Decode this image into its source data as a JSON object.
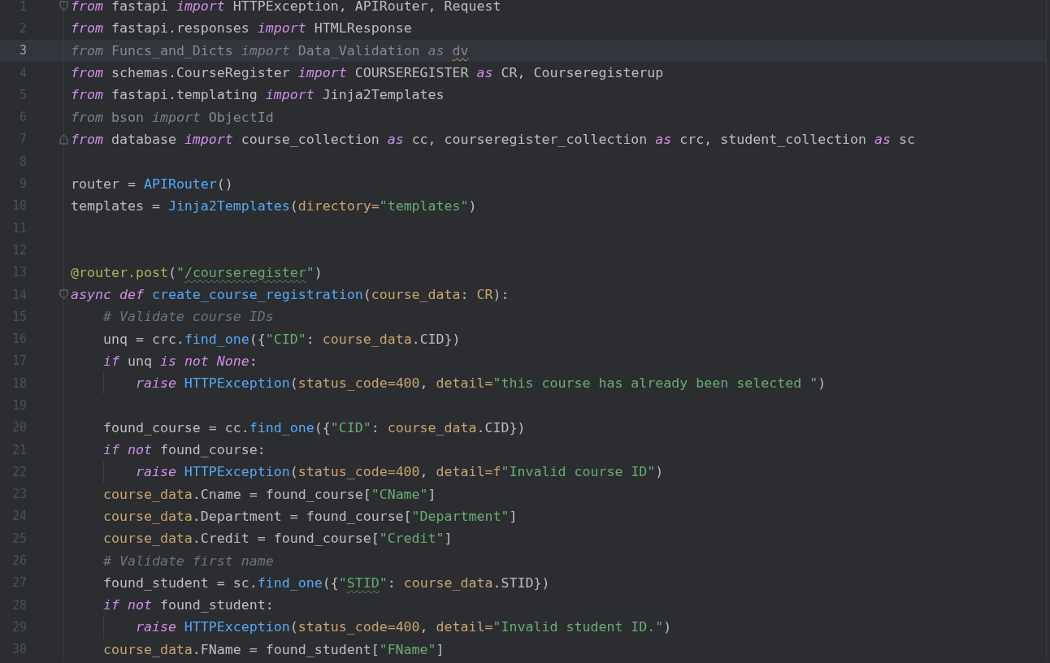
{
  "lines": [
    {
      "n": "1",
      "current": false,
      "fold_start": true,
      "tokens": [
        {
          "kind": "kw",
          "text": "from"
        },
        {
          "kind": "plain",
          "text": " fastapi "
        },
        {
          "kind": "kw",
          "text": "import"
        },
        {
          "kind": "plain",
          "text": " HTTPException, APIRouter, Request"
        }
      ]
    },
    {
      "n": "2",
      "current": false,
      "tokens": [
        {
          "kind": "kw",
          "text": "from"
        },
        {
          "kind": "plain",
          "text": " fastapi.responses "
        },
        {
          "kind": "kw",
          "text": "import"
        },
        {
          "kind": "plain",
          "text": " HTMLResponse"
        }
      ]
    },
    {
      "n": "3",
      "current": true,
      "tokens": [
        {
          "kind": "kwd",
          "text": "from"
        },
        {
          "kind": "dim",
          "text": " Funcs_and_Dicts "
        },
        {
          "kind": "kwd",
          "text": "import"
        },
        {
          "kind": "dim",
          "text": " Data_Validation "
        },
        {
          "kind": "kwd",
          "text": "as "
        },
        {
          "kind": "dim",
          "text": "dv",
          "warning": true
        }
      ]
    },
    {
      "n": "4",
      "current": false,
      "tokens": [
        {
          "kind": "kw",
          "text": "from"
        },
        {
          "kind": "plain",
          "text": " schemas.CourseRegister "
        },
        {
          "kind": "kw",
          "text": "import"
        },
        {
          "kind": "plain",
          "text": " COURSEREGISTER "
        },
        {
          "kind": "kw",
          "text": "as"
        },
        {
          "kind": "plain",
          "text": " CR, Courseregisterup"
        }
      ]
    },
    {
      "n": "5",
      "current": false,
      "tokens": [
        {
          "kind": "kw",
          "text": "from"
        },
        {
          "kind": "plain",
          "text": " fastapi.templating "
        },
        {
          "kind": "kw",
          "text": "import"
        },
        {
          "kind": "plain",
          "text": " Jinja2Templates"
        }
      ]
    },
    {
      "n": "6",
      "current": false,
      "tokens": [
        {
          "kind": "kwd",
          "text": "from"
        },
        {
          "kind": "dim",
          "text": " bson "
        },
        {
          "kind": "kwd",
          "text": "import"
        },
        {
          "kind": "dim",
          "text": " ObjectId"
        }
      ]
    },
    {
      "n": "7",
      "current": false,
      "fold_end": true,
      "tokens": [
        {
          "kind": "kw",
          "text": "from"
        },
        {
          "kind": "plain",
          "text": " database "
        },
        {
          "kind": "kw",
          "text": "import"
        },
        {
          "kind": "plain",
          "text": " course_collection "
        },
        {
          "kind": "kw",
          "text": "as"
        },
        {
          "kind": "plain",
          "text": " cc, courseregister_collection "
        },
        {
          "kind": "kw",
          "text": "as"
        },
        {
          "kind": "plain",
          "text": " crc, student_collection "
        },
        {
          "kind": "kw",
          "text": "as"
        },
        {
          "kind": "plain",
          "text": " sc"
        }
      ]
    },
    {
      "n": "8",
      "current": false
    },
    {
      "n": "9",
      "current": false,
      "tokens": [
        {
          "kind": "plain",
          "text": "router = "
        },
        {
          "kind": "fn",
          "text": "APIRouter"
        },
        {
          "kind": "plain",
          "text": "()"
        }
      ]
    },
    {
      "n": "10",
      "current": false,
      "tokens": [
        {
          "kind": "plain",
          "text": "templates = "
        },
        {
          "kind": "fn",
          "text": "Jinja2Templates"
        },
        {
          "kind": "plain",
          "text": "("
        },
        {
          "kind": "param",
          "text": "directory="
        },
        {
          "kind": "str",
          "text": "\"templates\""
        },
        {
          "kind": "plain",
          "text": ")"
        }
      ]
    },
    {
      "n": "11",
      "current": false
    },
    {
      "n": "12",
      "current": false
    },
    {
      "n": "13",
      "current": false,
      "tokens": [
        {
          "kind": "deco",
          "text": "@router.post"
        },
        {
          "kind": "plain",
          "text": "("
        },
        {
          "kind": "str",
          "text": "\""
        },
        {
          "kind": "str",
          "text": "/courseregister",
          "typo": true
        },
        {
          "kind": "str",
          "text": "\""
        },
        {
          "kind": "plain",
          "text": ")"
        }
      ]
    },
    {
      "n": "14",
      "current": false,
      "fold_start": true,
      "tokens": [
        {
          "kind": "kw",
          "text": "async def"
        },
        {
          "kind": "fn",
          "text": " create_course_registration"
        },
        {
          "kind": "plain",
          "text": "("
        },
        {
          "kind": "param",
          "text": "course_data"
        },
        {
          "kind": "plain",
          "text": ": "
        },
        {
          "kind": "param",
          "text": "CR"
        },
        {
          "kind": "plain",
          "text": "):"
        }
      ]
    },
    {
      "n": "15",
      "current": false,
      "tokens": [
        {
          "kind": "comment",
          "text": "    # Validate course IDs"
        }
      ]
    },
    {
      "n": "16",
      "current": false,
      "tokens": [
        {
          "kind": "plain",
          "text": "    unq = crc."
        },
        {
          "kind": "fn",
          "text": "find_one"
        },
        {
          "kind": "plain",
          "text": "({"
        },
        {
          "kind": "str",
          "text": "\"CID\""
        },
        {
          "kind": "plain",
          "text": ": "
        },
        {
          "kind": "param",
          "text": "course_data"
        },
        {
          "kind": "plain",
          "text": ".CID})"
        }
      ]
    },
    {
      "n": "17",
      "current": false,
      "tokens": [
        {
          "kind": "kw",
          "text": "    if"
        },
        {
          "kind": "plain",
          "text": " unq "
        },
        {
          "kind": "kw",
          "text": "is not None"
        },
        {
          "kind": "plain",
          "text": ":"
        }
      ]
    },
    {
      "n": "18",
      "current": false,
      "tokens": [
        {
          "kind": "kw",
          "text": "        raise"
        },
        {
          "kind": "fn",
          "text": " HTTPException"
        },
        {
          "kind": "plain",
          "text": "("
        },
        {
          "kind": "param",
          "text": "status_code=400"
        },
        {
          "kind": "plain",
          "text": ", "
        },
        {
          "kind": "param",
          "text": "detail="
        },
        {
          "kind": "str",
          "text": "\"this course has already been selected \""
        },
        {
          "kind": "plain",
          "text": ")"
        }
      ]
    },
    {
      "n": "19",
      "current": false
    },
    {
      "n": "20",
      "current": false,
      "tokens": [
        {
          "kind": "plain",
          "text": "    found_course = cc."
        },
        {
          "kind": "fn",
          "text": "find_one"
        },
        {
          "kind": "plain",
          "text": "({"
        },
        {
          "kind": "str",
          "text": "\"CID\""
        },
        {
          "kind": "plain",
          "text": ": "
        },
        {
          "kind": "param",
          "text": "course_data"
        },
        {
          "kind": "plain",
          "text": ".CID})"
        }
      ]
    },
    {
      "n": "21",
      "current": false,
      "tokens": [
        {
          "kind": "kw",
          "text": "    if not"
        },
        {
          "kind": "plain",
          "text": " found_course:"
        }
      ]
    },
    {
      "n": "22",
      "current": false,
      "tokens": [
        {
          "kind": "kw",
          "text": "        raise"
        },
        {
          "kind": "fn",
          "text": " HTTPException"
        },
        {
          "kind": "plain",
          "text": "("
        },
        {
          "kind": "param",
          "text": "status_code=400"
        },
        {
          "kind": "plain",
          "text": ", "
        },
        {
          "kind": "param",
          "text": "detail=f"
        },
        {
          "kind": "str",
          "text": "\"Invalid course ID\""
        },
        {
          "kind": "plain",
          "text": ")"
        }
      ]
    },
    {
      "n": "23",
      "current": false,
      "tokens": [
        {
          "kind": "param",
          "text": "    course_data"
        },
        {
          "kind": "plain",
          "text": ".Cname = found_course["
        },
        {
          "kind": "str",
          "text": "\"CName\""
        },
        {
          "kind": "plain",
          "text": "]"
        }
      ]
    },
    {
      "n": "24",
      "current": false,
      "tokens": [
        {
          "kind": "param",
          "text": "    course_data"
        },
        {
          "kind": "plain",
          "text": ".Department = found_course["
        },
        {
          "kind": "str",
          "text": "\"Department\""
        },
        {
          "kind": "plain",
          "text": "]"
        }
      ]
    },
    {
      "n": "25",
      "current": false,
      "tokens": [
        {
          "kind": "param",
          "text": "    course_data"
        },
        {
          "kind": "plain",
          "text": ".Credit = found_course["
        },
        {
          "kind": "str",
          "text": "\"Credit\""
        },
        {
          "kind": "plain",
          "text": "]"
        }
      ]
    },
    {
      "n": "26",
      "current": false,
      "tokens": [
        {
          "kind": "comment",
          "text": "    # Validate first name"
        }
      ]
    },
    {
      "n": "27",
      "current": false,
      "tokens": [
        {
          "kind": "plain",
          "text": "    found_student = sc."
        },
        {
          "kind": "fn",
          "text": "find_one"
        },
        {
          "kind": "plain",
          "text": "({"
        },
        {
          "kind": "str",
          "text": "\""
        },
        {
          "kind": "str",
          "text": "STID",
          "typo": true
        },
        {
          "kind": "str",
          "text": "\""
        },
        {
          "kind": "plain",
          "text": ": "
        },
        {
          "kind": "param",
          "text": "course_data"
        },
        {
          "kind": "plain",
          "text": ".STID})"
        }
      ]
    },
    {
      "n": "28",
      "current": false,
      "tokens": [
        {
          "kind": "kw",
          "text": "    if not"
        },
        {
          "kind": "plain",
          "text": " found_student:"
        }
      ]
    },
    {
      "n": "29",
      "current": false,
      "tokens": [
        {
          "kind": "kw",
          "text": "        raise"
        },
        {
          "kind": "fn",
          "text": " HTTPException"
        },
        {
          "kind": "plain",
          "text": "("
        },
        {
          "kind": "param",
          "text": "status_code=400"
        },
        {
          "kind": "plain",
          "text": ", "
        },
        {
          "kind": "param",
          "text": "detail="
        },
        {
          "kind": "str",
          "text": "\"Invalid student ID.\""
        },
        {
          "kind": "plain",
          "text": ")"
        }
      ]
    },
    {
      "n": "30",
      "current": false,
      "tokens": [
        {
          "kind": "param",
          "text": "    course_data"
        },
        {
          "kind": "plain",
          "text": ".FName = found_student["
        },
        {
          "kind": "str",
          "text": "\"FName\""
        },
        {
          "kind": "plain",
          "text": "]"
        }
      ]
    }
  ]
}
